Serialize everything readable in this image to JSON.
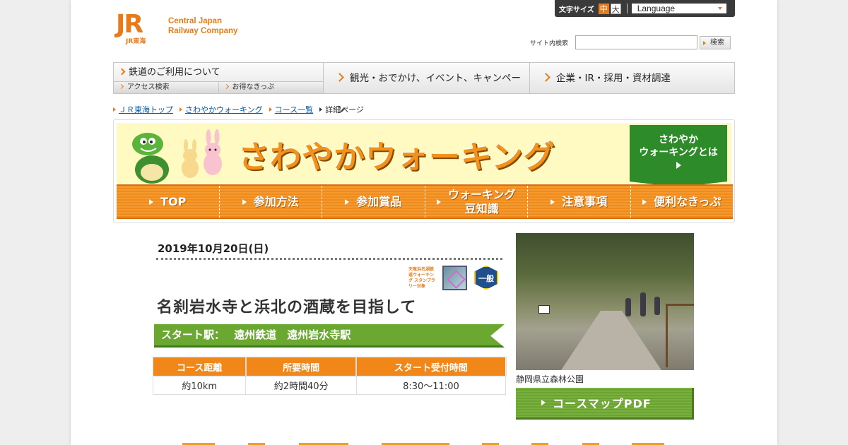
{
  "utility": {
    "font_size_label": "文字サイズ",
    "size_mid": "中",
    "size_big": "大",
    "language": "Language"
  },
  "logo": {
    "mark": "JR",
    "sub": "JR東海",
    "name_line1": "Central Japan",
    "name_line2": "Railway Company"
  },
  "search": {
    "label": "サイト内検索",
    "placeholder": "",
    "button": "検索"
  },
  "gnav": {
    "railway": "鉄道のご利用について",
    "access": "アクセス検索",
    "tickets": "お得なきっぷ",
    "tourism": "観光・おでかけ、イベント、キャンペーン",
    "corporate": "企業・IR・採用・資材調達"
  },
  "breadcrumb": [
    "ＪＲ東海トップ",
    "さわやかウォーキング",
    "コース一覧",
    "詳細ページ"
  ],
  "banner": {
    "title": "さわやかウォーキング",
    "about_line1": "さわやか",
    "about_line2": "ウォーキングとは",
    "nav": [
      "TOP",
      "参加方法",
      "参加賞品",
      "ウォーキング\n豆知識",
      "注意事項",
      "便利なきっぷ"
    ]
  },
  "event": {
    "date": "2019年10月20日(日)",
    "icon1_text": "天竜浜名湖鉄道ウォーキング スタンプラリー対象",
    "icon3_text": "一般向",
    "title": "名刹岩水寺と浜北の酒蔵を目指して",
    "start_label": "スタート駅：",
    "start_station": "遠州鉄道　遠州岩水寺駅",
    "table": {
      "headers": [
        "コース距離",
        "所要時間",
        "スタート受付時間"
      ],
      "values": [
        "約10km",
        "約2時間40分",
        "8:30～11:00"
      ]
    },
    "photo_caption": "静岡県立森林公園",
    "pdf_button": "コースマップPDF"
  },
  "colors": {
    "accent": "#e87b19",
    "green": "#6aa832",
    "link": "#0058a8"
  }
}
